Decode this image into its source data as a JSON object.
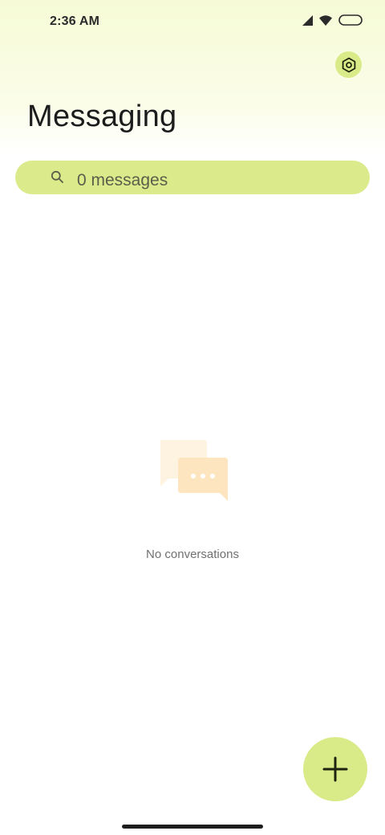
{
  "status_bar": {
    "time": "2:36 AM",
    "icons": [
      "signal-icon",
      "wifi-icon",
      "battery-icon"
    ]
  },
  "header": {
    "title": "Messaging",
    "settings_icon": "settings-hexagon-icon"
  },
  "search": {
    "text": "0 messages",
    "icon": "search-icon"
  },
  "empty_state": {
    "icon": "chat-bubbles-icon",
    "text": "No conversations"
  },
  "fab": {
    "icon": "plus-icon"
  },
  "colors": {
    "accent": "#d9eb88",
    "search_bg": "#dbeb8c",
    "header_tint": "#f6fbd6",
    "illustration_back": "#fdf3e0",
    "illustration_front": "#fde6bf"
  }
}
